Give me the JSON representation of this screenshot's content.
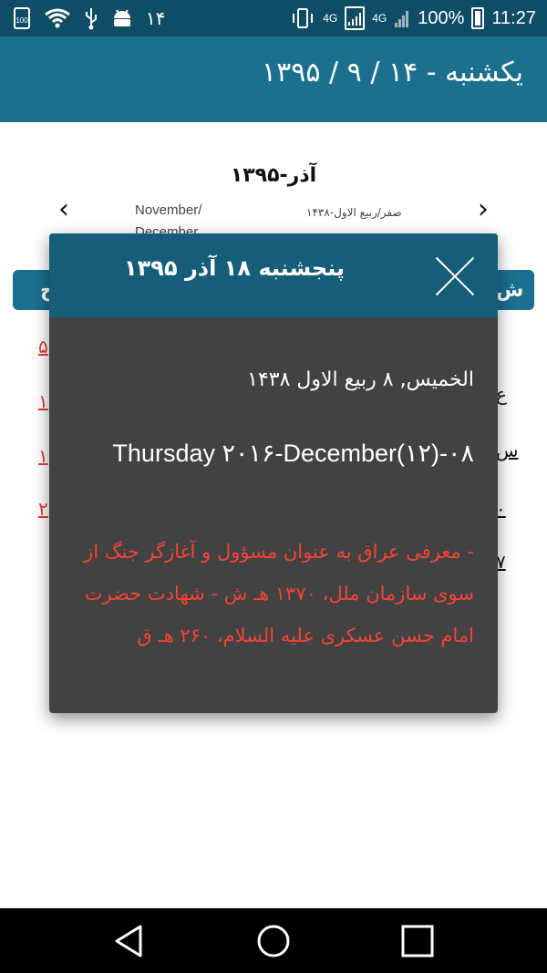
{
  "status_bar": {
    "left_text": "۱۴",
    "network": "4G",
    "sim2": "4G",
    "battery_percent": "100%",
    "time": "11:27",
    "icons": [
      "storage-100-icon",
      "wifi-icon",
      "usb-icon",
      "android-icon",
      "vibrate-icon",
      "signal-icon",
      "battery-charging-icon"
    ]
  },
  "app_bar": {
    "title": "یکشنبه  -  ۱۴ / ۹ / ۱۳۹۵"
  },
  "calendar": {
    "month_title": "آذر-۱۳۹۵",
    "gregorian_months": "November/",
    "gregorian_months_2": "December",
    "hijri_months": "صفر/ربیع الاول-۱۴۳۸",
    "prev_icon": "chevron-left-icon",
    "next_icon": "chevron-right-icon",
    "weekday_left": "ج",
    "weekday_right": "ش",
    "left_column": [
      "۵",
      "۱",
      "۱",
      "۲"
    ],
    "right_column": [
      "ع",
      "س",
      "۰",
      "۷"
    ]
  },
  "dialog": {
    "title": "پنجشنبه  ۱۸  آذر  ۱۳۹۵",
    "hijri_date": "الخمیس, ۸ ربیع الاول ۱۴۳۸",
    "gregorian_date": "Thursday ۲۰۱۶-December(۱۲)-۰۸",
    "events": "- معرفی عراق به عنوان مسؤول و آغازگر جنگ از سوی سازمان ملل، ۱۳۷۰ هـ ش - شهادت حضرت امام حسن عسکری علیه السلام، ۲۶۰ هـ ق",
    "close_icon": "close-icon"
  },
  "nav_bar": {
    "icons": [
      "back-icon",
      "home-icon",
      "recents-icon"
    ]
  },
  "colors": {
    "status_bar": "#0f4d66",
    "app_bar": "#1b6f8f",
    "dialog_header": "#155d79",
    "dialog_body": "#424242",
    "event_text": "#f44336"
  }
}
